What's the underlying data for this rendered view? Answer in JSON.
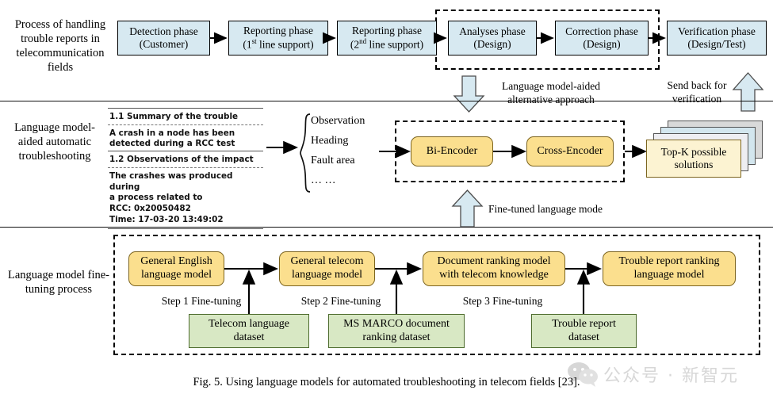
{
  "figure": {
    "caption": "Fig. 5.   Using language models for automated troubleshooting in telecom fields [23]."
  },
  "row_labels": {
    "top": "Process of handling trouble reports in telecommunication fields",
    "middle": "Language model-aided automatic troubleshooting",
    "bottom": "Language model fine-tuning process"
  },
  "process_row": {
    "boxes": [
      {
        "line1": "Detection phase",
        "line2": "(Customer)"
      },
      {
        "line1": "Reporting phase",
        "line2_pre": "(1",
        "line2_sup": "st",
        "line2_post": " line support)"
      },
      {
        "line1": "Reporting phase",
        "line2_pre": "(2",
        "line2_sup": "nd",
        "line2_post": " line support)"
      },
      {
        "line1": "Analyses phase",
        "line2": "(Design)"
      },
      {
        "line1": "Correction phase",
        "line2": "(Design)"
      },
      {
        "line1": "Verification phase",
        "line2": "(Design/Test)"
      }
    ]
  },
  "annotations": {
    "alternative_approach": "Language model-aided alternative approach",
    "send_back": "Send back for verification",
    "fine_tuned_mode": "Fine-tuned language mode"
  },
  "trouble_report": {
    "heading1": "1.1 Summary of the trouble",
    "body1_line1": "A crash in a node has been",
    "body1_line2": "detected during a RCC test",
    "heading2": "1.2 Observations of the impact",
    "body2_line1": "The crashes was produced during",
    "body2_line2": "a process related to",
    "body2_line3": "RCC: 0x20050482",
    "body2_line4": "Time: 17-03-20 13:49:02"
  },
  "field_list": {
    "items": [
      "Observation",
      "Heading",
      "Fault area",
      "… …"
    ]
  },
  "pipeline": {
    "bi_encoder": "Bi-Encoder",
    "cross_encoder": "Cross-Encoder",
    "solutions_line1": "Top-K possible",
    "solutions_line2": "solutions"
  },
  "finetuning": {
    "models": [
      {
        "line1": "General English",
        "line2": "language model"
      },
      {
        "line1": "General telecom",
        "line2": "language model"
      },
      {
        "line1": "Document ranking model",
        "line2": "with telecom knowledge"
      },
      {
        "line1": "Trouble report ranking",
        "line2": "language model"
      }
    ],
    "steps": [
      "Step 1 Fine-tuning",
      "Step 2 Fine-tuning",
      "Step 3 Fine-tuning"
    ],
    "datasets": [
      {
        "line1": "Telecom language",
        "line2": "dataset"
      },
      {
        "line1": "MS MARCO document",
        "line2": "ranking dataset"
      },
      {
        "line1": "Trouble report",
        "line2": "dataset"
      }
    ]
  },
  "watermark": {
    "text": "公众号 · 新智元"
  },
  "colors": {
    "phase_fill": "#d7e9f1",
    "model_fill": "#fbdf8e",
    "dataset_fill": "#d8e8c4",
    "solutions_fill": "#fcf3d2",
    "block_arrow_fill": "#d7e9f1",
    "stroke": "#000000"
  }
}
